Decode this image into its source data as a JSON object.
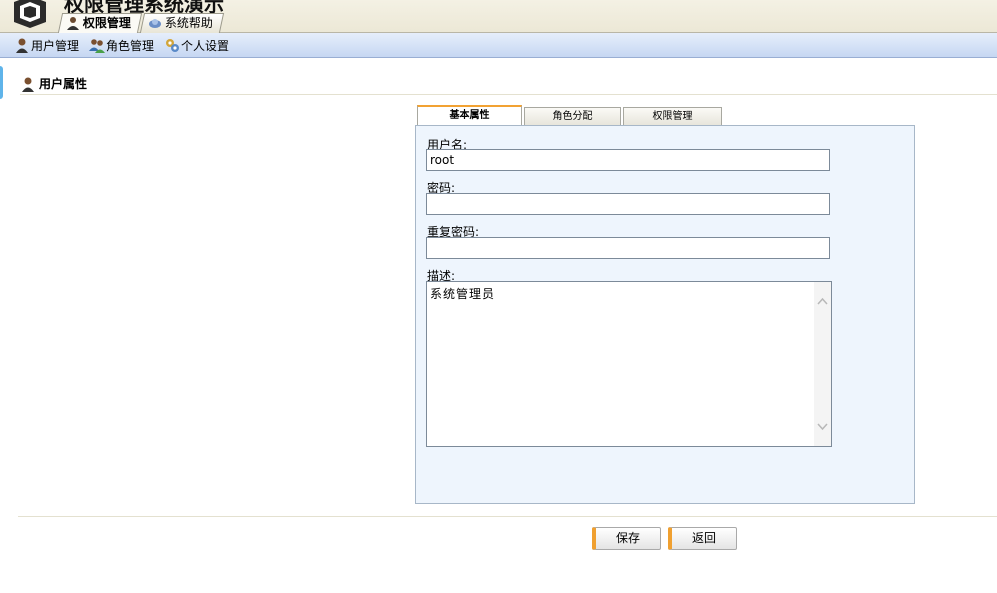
{
  "app": {
    "title": "权限管理系统演示"
  },
  "top_tabs": [
    {
      "label": "权限管理",
      "icon": "user-icon"
    },
    {
      "label": "系统帮助",
      "icon": "help-icon"
    }
  ],
  "nav": {
    "items": [
      {
        "label": "用户管理",
        "icon": "user-icon"
      },
      {
        "label": "角色管理",
        "icon": "users-icon"
      },
      {
        "label": "个人设置",
        "icon": "settings-icon"
      }
    ]
  },
  "section": {
    "title": "用户属性"
  },
  "inner_tabs": [
    {
      "label": "基本属性"
    },
    {
      "label": "角色分配"
    },
    {
      "label": "权限管理"
    }
  ],
  "form": {
    "username_label": "用户名:",
    "username_value": "root",
    "password_label": "密码:",
    "password_value": "",
    "repeat_password_label": "重复密码:",
    "repeat_password_value": "",
    "description_label": "描述:",
    "description_value": "系统管理员"
  },
  "buttons": {
    "save": "保存",
    "back": "返回"
  },
  "colors": {
    "accent": "#f2a233",
    "nav_bg": "#c6d7f2",
    "panel_bg": "#eef5fd"
  }
}
